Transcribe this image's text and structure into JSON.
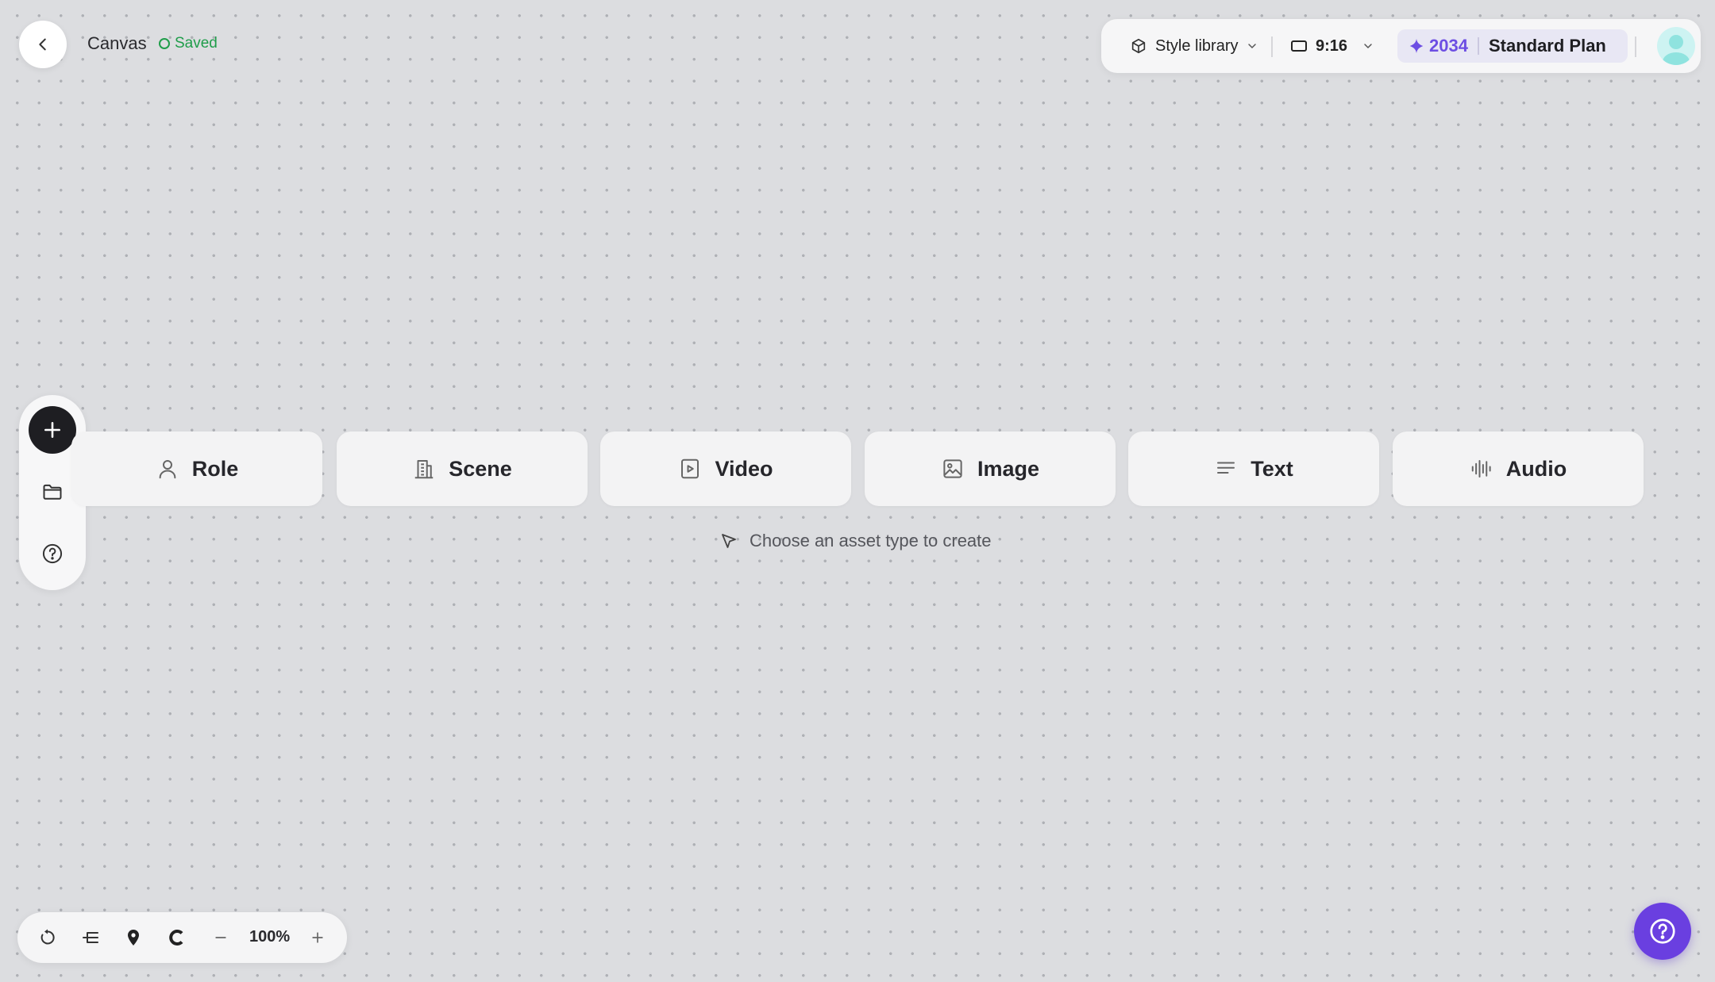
{
  "header": {
    "title": "Canvas",
    "status": "Saved"
  },
  "toolbar": {
    "style_library_label": "Style library",
    "aspect_ratio": "9:16",
    "credits": "2034",
    "plan_name": "Standard Plan"
  },
  "asset_types": [
    {
      "label": "Role",
      "icon": "user-icon"
    },
    {
      "label": "Scene",
      "icon": "building-icon"
    },
    {
      "label": "Video",
      "icon": "play-square-icon"
    },
    {
      "label": "Image",
      "icon": "image-icon"
    },
    {
      "label": "Text",
      "icon": "text-lines-icon"
    },
    {
      "label": "Audio",
      "icon": "waveform-icon"
    }
  ],
  "hint": "Choose an asset type to create",
  "zoom": {
    "level": "100%"
  },
  "colors": {
    "accent": "#6a3fe0",
    "credits": "#6d4ee3",
    "saved": "#1f9d4a",
    "background": "#dcdde0"
  }
}
